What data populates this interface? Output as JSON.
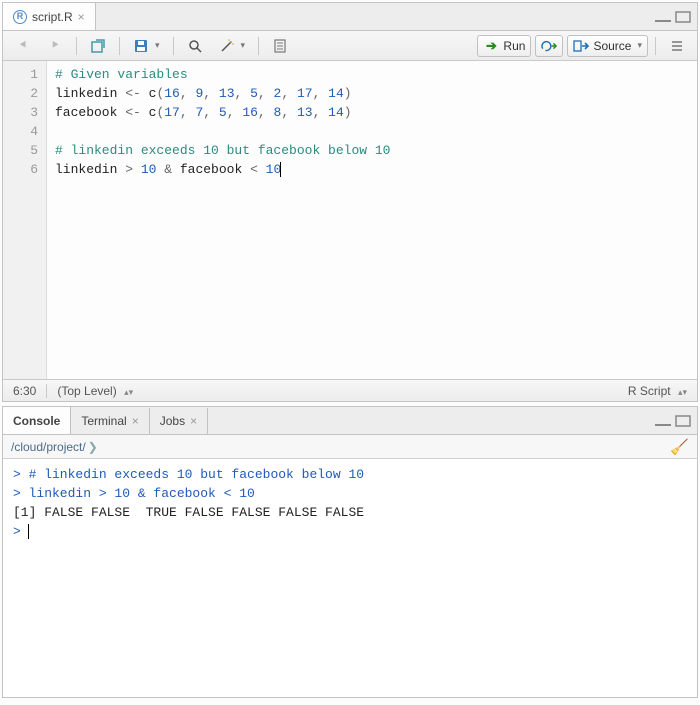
{
  "source_tab": {
    "filename": "script.R",
    "icon": "r-file-icon"
  },
  "toolbar": {
    "run": "Run",
    "source": "Source"
  },
  "editor": {
    "lines": [
      {
        "n": 1,
        "tokens": [
          [
            "comment",
            "# Given variables"
          ]
        ]
      },
      {
        "n": 2,
        "tokens": [
          [
            "ident",
            "linkedin "
          ],
          [
            "op",
            "<- "
          ],
          [
            "ident",
            "c"
          ],
          [
            "op",
            "("
          ],
          [
            "num",
            "16"
          ],
          [
            "op",
            ", "
          ],
          [
            "num",
            "9"
          ],
          [
            "op",
            ", "
          ],
          [
            "num",
            "13"
          ],
          [
            "op",
            ", "
          ],
          [
            "num",
            "5"
          ],
          [
            "op",
            ", "
          ],
          [
            "num",
            "2"
          ],
          [
            "op",
            ", "
          ],
          [
            "num",
            "17"
          ],
          [
            "op",
            ", "
          ],
          [
            "num",
            "14"
          ],
          [
            "op",
            ")"
          ]
        ]
      },
      {
        "n": 3,
        "tokens": [
          [
            "ident",
            "facebook "
          ],
          [
            "op",
            "<- "
          ],
          [
            "ident",
            "c"
          ],
          [
            "op",
            "("
          ],
          [
            "num",
            "17"
          ],
          [
            "op",
            ", "
          ],
          [
            "num",
            "7"
          ],
          [
            "op",
            ", "
          ],
          [
            "num",
            "5"
          ],
          [
            "op",
            ", "
          ],
          [
            "num",
            "16"
          ],
          [
            "op",
            ", "
          ],
          [
            "num",
            "8"
          ],
          [
            "op",
            ", "
          ],
          [
            "num",
            "13"
          ],
          [
            "op",
            ", "
          ],
          [
            "num",
            "14"
          ],
          [
            "op",
            ")"
          ]
        ]
      },
      {
        "n": 4,
        "tokens": []
      },
      {
        "n": 5,
        "tokens": [
          [
            "comment",
            "# linkedin exceeds 10 but facebook below 10"
          ]
        ]
      },
      {
        "n": 6,
        "tokens": [
          [
            "ident",
            "linkedin "
          ],
          [
            "op",
            "> "
          ],
          [
            "num",
            "10"
          ],
          [
            "op",
            " & "
          ],
          [
            "ident",
            "facebook "
          ],
          [
            "op",
            "< "
          ],
          [
            "num",
            "10"
          ]
        ],
        "cursor": true
      }
    ]
  },
  "statusbar": {
    "cursor": "6:30",
    "scope": "(Top Level)",
    "mode": "R Script"
  },
  "console_tabs": [
    "Console",
    "Terminal",
    "Jobs"
  ],
  "console_active": 0,
  "path": "/cloud/project/",
  "console_output": [
    {
      "kind": "prompt",
      "text": "> # linkedin exceeds 10 but facebook below 10"
    },
    {
      "kind": "prompt",
      "text": "> linkedin > 10 & facebook < 10"
    },
    {
      "kind": "out",
      "text": "[1] FALSE FALSE  TRUE FALSE FALSE FALSE FALSE"
    },
    {
      "kind": "prompt",
      "text": "> "
    }
  ]
}
